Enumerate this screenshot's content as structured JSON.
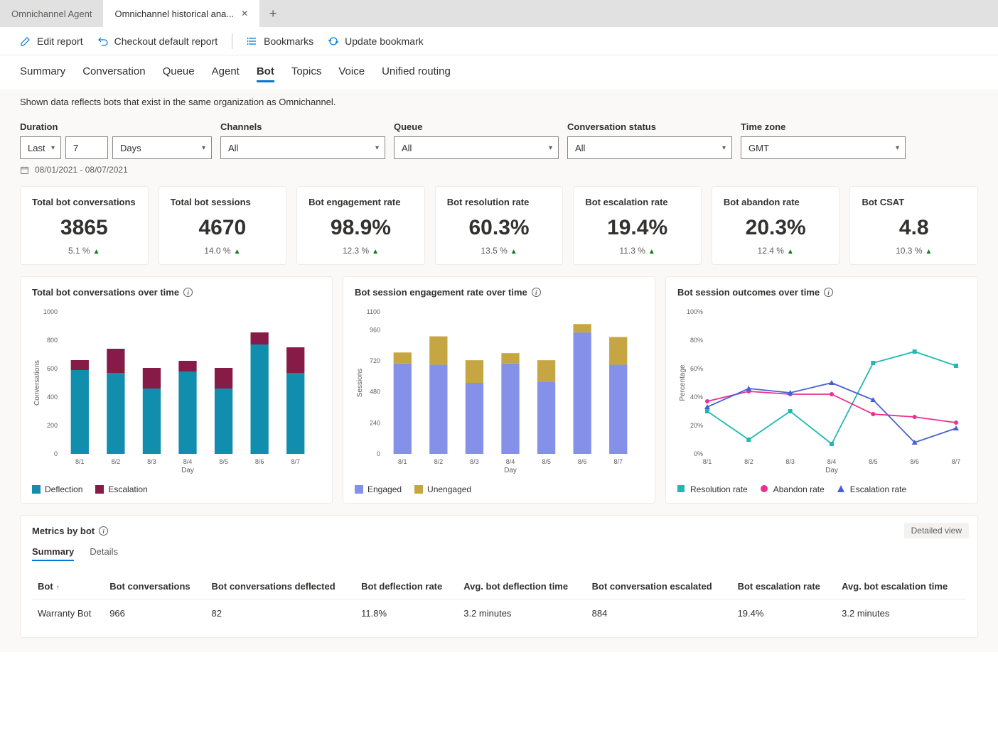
{
  "tabs": {
    "inactive": "Omnichannel Agent",
    "active": "Omnichannel historical ana..."
  },
  "toolbar": {
    "edit": "Edit report",
    "checkout": "Checkout default report",
    "bookmarks": "Bookmarks",
    "update": "Update bookmark"
  },
  "nav": [
    "Summary",
    "Conversation",
    "Queue",
    "Agent",
    "Bot",
    "Topics",
    "Voice",
    "Unified routing"
  ],
  "nav_active": "Bot",
  "note": "Shown data reflects bots that exist in the same organization as Omnichannel.",
  "filters": {
    "duration": {
      "label": "Duration",
      "v1": "Last",
      "v2": "7",
      "v3": "Days"
    },
    "channels": {
      "label": "Channels",
      "v": "All"
    },
    "queue": {
      "label": "Queue",
      "v": "All"
    },
    "status": {
      "label": "Conversation status",
      "v": "All"
    },
    "tz": {
      "label": "Time zone",
      "v": "GMT"
    }
  },
  "date_range": "08/01/2021 - 08/07/2021",
  "kpis": [
    {
      "title": "Total bot conversations",
      "value": "3865",
      "delta": "5.1 %"
    },
    {
      "title": "Total bot sessions",
      "value": "4670",
      "delta": "14.0 %"
    },
    {
      "title": "Bot engagement rate",
      "value": "98.9%",
      "delta": "12.3 %"
    },
    {
      "title": "Bot resolution rate",
      "value": "60.3%",
      "delta": "13.5 %"
    },
    {
      "title": "Bot escalation rate",
      "value": "19.4%",
      "delta": "11.3 %"
    },
    {
      "title": "Bot abandon rate",
      "value": "20.3%",
      "delta": "12.4 %"
    },
    {
      "title": "Bot CSAT",
      "value": "4.8",
      "delta": "10.3 %"
    }
  ],
  "chart_data": [
    {
      "type": "bar",
      "title": "Total bot conversations over time",
      "xlabel": "Day",
      "ylabel": "Conversations",
      "ylim": [
        0,
        1000
      ],
      "yticks": [
        0,
        200,
        400,
        600,
        800,
        1000
      ],
      "categories": [
        "8/1",
        "8/2",
        "8/3",
        "8/4",
        "8/5",
        "8/6",
        "8/7"
      ],
      "series": [
        {
          "name": "Deflection",
          "color": "#118dad",
          "values": [
            590,
            570,
            460,
            580,
            460,
            770,
            570
          ]
        },
        {
          "name": "Escalation",
          "color": "#861b48",
          "values": [
            70,
            170,
            145,
            75,
            145,
            85,
            180
          ]
        }
      ]
    },
    {
      "type": "bar",
      "title": "Bot session engagement rate over time",
      "xlabel": "Day",
      "ylabel": "Sessions",
      "ylim": [
        0,
        1100
      ],
      "yticks": [
        0,
        240,
        480,
        720,
        960,
        1100
      ],
      "categories": [
        "8/1",
        "8/2",
        "8/3",
        "8/4",
        "8/5",
        "8/6",
        "8/7"
      ],
      "series": [
        {
          "name": "Engaged",
          "color": "#8590e8",
          "values": [
            700,
            690,
            550,
            700,
            560,
            940,
            690
          ]
        },
        {
          "name": "Unengaged",
          "color": "#c6a642",
          "values": [
            85,
            220,
            175,
            80,
            165,
            65,
            215
          ]
        }
      ]
    },
    {
      "type": "line",
      "title": "Bot session outcomes over time",
      "xlabel": "Day",
      "ylabel": "Percentage",
      "ylim": [
        0,
        100
      ],
      "yticks": [
        0,
        20,
        40,
        60,
        80,
        100
      ],
      "categories": [
        "8/1",
        "8/2",
        "8/3",
        "8/4",
        "8/5",
        "8/6",
        "8/7"
      ],
      "series": [
        {
          "name": "Resolution rate",
          "color": "#1fb9b2",
          "marker": "square",
          "values": [
            30,
            10,
            30,
            7,
            64,
            72,
            62
          ]
        },
        {
          "name": "Abandon rate",
          "color": "#ec2f90",
          "marker": "circle",
          "values": [
            37,
            44,
            42,
            42,
            28,
            26,
            22
          ]
        },
        {
          "name": "Escalation rate",
          "color": "#4661d5",
          "marker": "triangle",
          "values": [
            33,
            46,
            43,
            50,
            38,
            8,
            18
          ]
        }
      ]
    }
  ],
  "metrics": {
    "title": "Metrics by bot",
    "detailed": "Detailed view",
    "tabs": [
      "Summary",
      "Details"
    ],
    "columns": [
      "Bot",
      "Bot conversations",
      "Bot conversations deflected",
      "Bot deflection rate",
      "Avg. bot deflection time",
      "Bot conversation escalated",
      "Bot escalation rate",
      "Avg. bot escalation time"
    ],
    "rows": [
      [
        "Warranty Bot",
        "966",
        "82",
        "11.8%",
        "3.2 minutes",
        "884",
        "19.4%",
        "3.2 minutes"
      ]
    ]
  }
}
